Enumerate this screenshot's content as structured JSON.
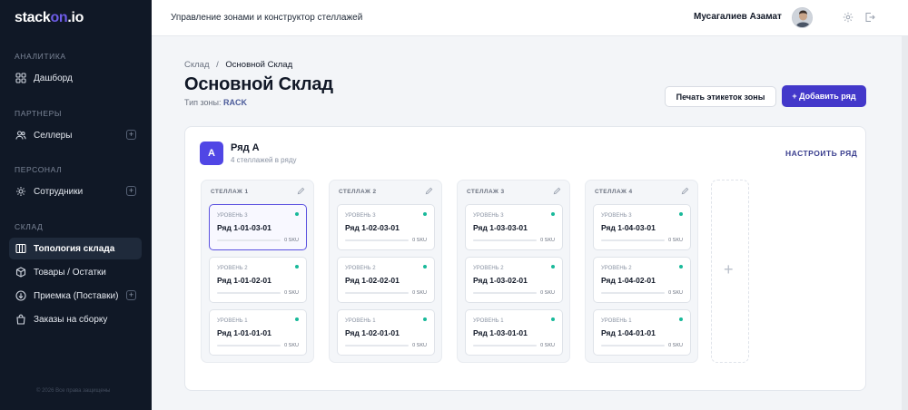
{
  "brand": {
    "prefix": "stack",
    "accent": "on",
    "suffix": ".io"
  },
  "sidebar": {
    "sections": [
      {
        "label": "АНАЛИТИКА"
      },
      {
        "label": "ПАРТНЕРЫ"
      },
      {
        "label": "ПЕРСОНАЛ"
      },
      {
        "label": "СКЛАД"
      }
    ],
    "items": [
      {
        "label": "Дашборд",
        "icon": "grid-icon"
      },
      {
        "label": "Селлеры",
        "icon": "users-icon",
        "plus": "+"
      },
      {
        "label": "Сотрудники",
        "icon": "gear-people-icon",
        "plus": "+"
      },
      {
        "label": "Топология склада",
        "icon": "columns-icon",
        "active": true
      },
      {
        "label": "Товары / Остатки",
        "icon": "box-icon"
      },
      {
        "label": "Приемка (Поставки)",
        "icon": "download-circle-icon",
        "plus": "+"
      },
      {
        "label": "Заказы на сборку",
        "icon": "bag-icon"
      }
    ],
    "copyright": "© 2026 Все права защищены"
  },
  "header": {
    "title": "Управление зонами и конструктор стеллажей",
    "user_name": "Мусагалиев Азамат"
  },
  "page": {
    "breadcrumb_root": "Склад",
    "breadcrumb_sep": "/",
    "breadcrumb_current": "Основной Склад",
    "title": "Основной Склад",
    "zone_type_label": "Тип зоны:",
    "zone_type_value": "RACK",
    "print_button": "Печать этикеток зоны",
    "add_row_button": "+ Добавить ряд"
  },
  "row": {
    "badge": "A",
    "name": "Ряд A",
    "subtitle": "4 стеллажей в ряду",
    "configure": "НАСТРОИТЬ РЯД",
    "add_rack": "+",
    "racks": [
      {
        "title": "СТЕЛЛАЖ 1",
        "cells": [
          {
            "level": "УРОВЕНЬ 3",
            "code": "Ряд 1-01-03-01",
            "sku": "0 SKU",
            "selected": true
          },
          {
            "level": "УРОВЕНЬ 2",
            "code": "Ряд 1-01-02-01",
            "sku": "0 SKU"
          },
          {
            "level": "УРОВЕНЬ 1",
            "code": "Ряд 1-01-01-01",
            "sku": "0 SKU"
          }
        ]
      },
      {
        "title": "СТЕЛЛАЖ 2",
        "cells": [
          {
            "level": "УРОВЕНЬ 3",
            "code": "Ряд 1-02-03-01",
            "sku": "0 SKU"
          },
          {
            "level": "УРОВЕНЬ 2",
            "code": "Ряд 1-02-02-01",
            "sku": "0 SKU"
          },
          {
            "level": "УРОВЕНЬ 1",
            "code": "Ряд 1-02-01-01",
            "sku": "0 SKU"
          }
        ]
      },
      {
        "title": "СТЕЛЛАЖ 3",
        "cells": [
          {
            "level": "УРОВЕНЬ 3",
            "code": "Ряд 1-03-03-01",
            "sku": "0 SKU"
          },
          {
            "level": "УРОВЕНЬ 2",
            "code": "Ряд 1-03-02-01",
            "sku": "0 SKU"
          },
          {
            "level": "УРОВЕНЬ 1",
            "code": "Ряд 1-03-01-01",
            "sku": "0 SKU"
          }
        ]
      },
      {
        "title": "СТЕЛЛАЖ 4",
        "cells": [
          {
            "level": "УРОВЕНЬ 3",
            "code": "Ряд 1-04-03-01",
            "sku": "0 SKU"
          },
          {
            "level": "УРОВЕНЬ 2",
            "code": "Ряд 1-04-02-01",
            "sku": "0 SKU"
          },
          {
            "level": "УРОВЕНЬ 1",
            "code": "Ряд 1-04-01-01",
            "sku": "0 SKU"
          }
        ]
      }
    ]
  },
  "colors": {
    "sidebar_bg": "#101826",
    "accent": "#4338ca",
    "status_dot": "#19b99a"
  }
}
